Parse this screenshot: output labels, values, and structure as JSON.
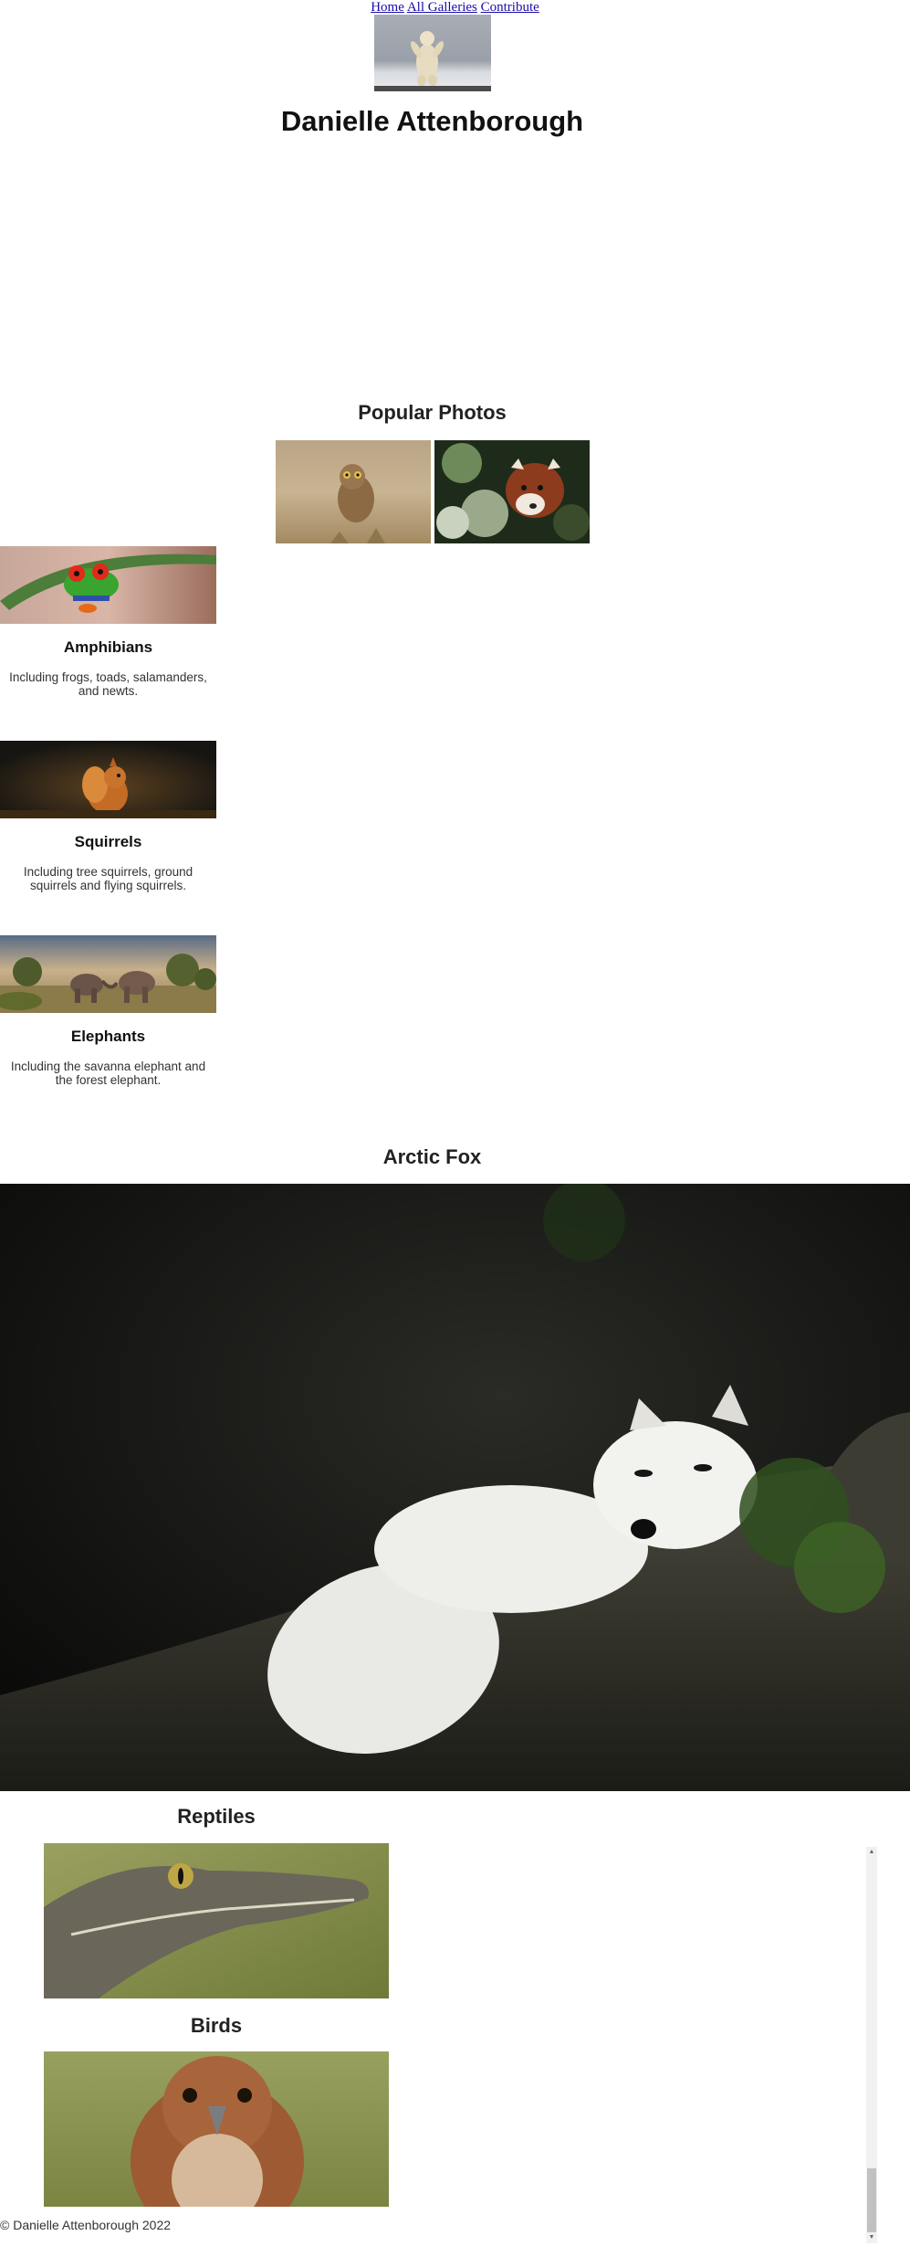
{
  "nav": {
    "links": [
      "Home",
      "All Galleries",
      "Contribute"
    ]
  },
  "header": {
    "logo_icon": "polar-bear-photo",
    "site_title": "Danielle Attenborough"
  },
  "popular": {
    "title": "Popular Photos",
    "photos": [
      {
        "icon": "burrowing-owl-photo"
      },
      {
        "icon": "red-panda-photo"
      }
    ]
  },
  "categories": [
    {
      "title": "Amphibians",
      "description": "Including frogs, toads, salamanders, and newts.",
      "icon": "tree-frog-photo"
    },
    {
      "title": "Squirrels",
      "description": "Including tree squirrels, ground squirrels and flying squirrels.",
      "icon": "squirrel-photo"
    },
    {
      "title": "Elephants",
      "description": "Including the savanna elephant and the forest elephant.",
      "icon": "elephants-photo"
    }
  ],
  "featured": {
    "title": "Arctic Fox",
    "icon": "arctic-fox-photo"
  },
  "gallery_list": [
    {
      "title": "Reptiles",
      "icon": "crocodile-photo"
    },
    {
      "title": "Birds",
      "icon": "hawk-photo"
    }
  ],
  "footer": {
    "copyright": "© Danielle Attenborough 2022"
  },
  "colors": {
    "link": "#1a0dab",
    "background": "#ffffff",
    "scrollbar_track": "#f1f1f1",
    "scrollbar_thumb": "#c1c1c1"
  }
}
